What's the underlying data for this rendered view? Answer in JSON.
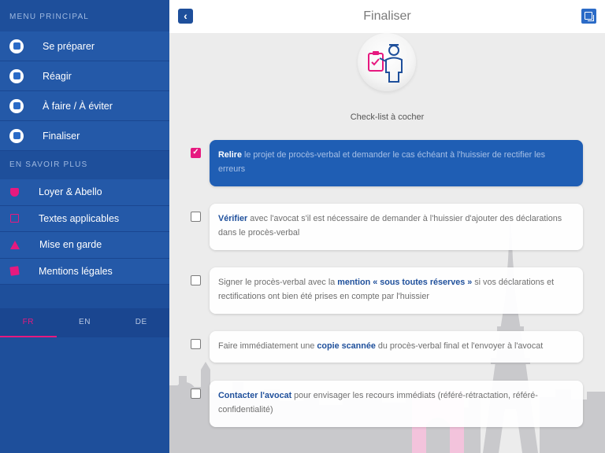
{
  "sidebar": {
    "section1": "MENU PRINCIPAL",
    "main_items": [
      {
        "label": "Se préparer",
        "icon": "prepare-icon"
      },
      {
        "label": "Réagir",
        "icon": "react-icon"
      },
      {
        "label": "À faire / À éviter",
        "icon": "do-dont-icon"
      },
      {
        "label": "Finaliser",
        "icon": "finalize-icon"
      }
    ],
    "section2": "EN SAVOIR PLUS",
    "sub_items": [
      {
        "label": "Loyer & Abello",
        "icon": "shield-icon"
      },
      {
        "label": "Textes applicables",
        "icon": "document-icon"
      },
      {
        "label": "Mise en garde",
        "icon": "warning-icon"
      },
      {
        "label": "Mentions légales",
        "icon": "legal-icon"
      }
    ],
    "languages": [
      "FR",
      "EN",
      "DE"
    ],
    "active_language": "FR"
  },
  "header": {
    "title": "Finaliser",
    "back_icon": "chevron-left-icon",
    "menu_icon": "window-toggle-icon",
    "back_glyph": "‹"
  },
  "hero": {
    "icon": "clipboard-person-icon"
  },
  "checklist_label": "Check-list à cocher",
  "items": [
    {
      "checked": true,
      "bold": "Relire",
      "text": " le projet de procès-verbal et demander le cas échéant à l'huissier de rectifier les erreurs",
      "check_glyph": "✓"
    },
    {
      "checked": false,
      "bold": "Vérifier",
      "text": " avec l'avocat s'il est nécessaire de demander à l'huissier d'ajouter des déclarations dans le procès-verbal"
    },
    {
      "checked": false,
      "pre": "Signer le procès-verbal avec la ",
      "bold": "mention « sous toutes réserves »",
      "text": " si vos déclarations et rectifications ont bien été prises en compte par l'huissier"
    },
    {
      "checked": false,
      "pre": "Faire immédiatement une ",
      "bold": "copie scannée",
      "text": " du procès-verbal final et l'envoyer à l'avocat"
    },
    {
      "checked": false,
      "bold": "Contacter l'avocat",
      "text": " pour envisager les recours immédiats (référé-rétractation, référé-confidentialité)"
    }
  ],
  "colors": {
    "primary": "#1e4f9b",
    "accent": "#e6197f",
    "card_active": "#1f5eb4"
  }
}
